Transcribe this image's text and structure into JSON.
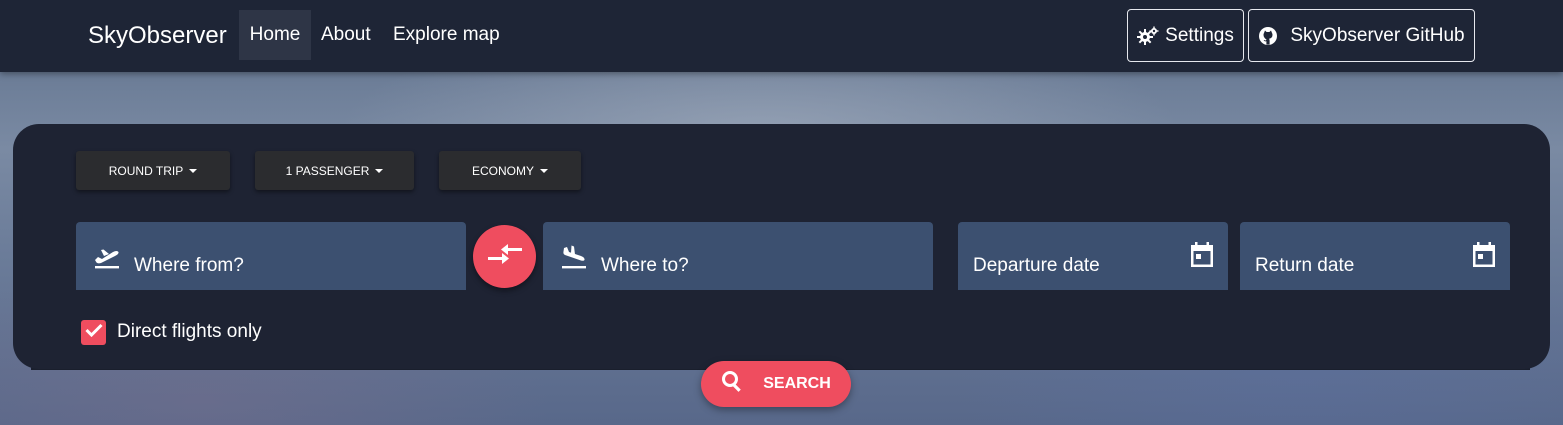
{
  "nav": {
    "brand": "SkyObserver",
    "links": [
      {
        "label": "Home",
        "active": true
      },
      {
        "label": "About",
        "active": false
      },
      {
        "label": "Explore map",
        "active": false
      }
    ],
    "settings_label": "Settings",
    "github_label": "SkyObserver GitHub"
  },
  "search": {
    "trip_type": "ROUND TRIP",
    "passengers": "1 PASSENGER",
    "cabin_class": "ECONOMY",
    "from_label": "Where from?",
    "to_label": "Where to?",
    "departure_label": "Departure date",
    "return_label": "Return date",
    "direct_only_label": "Direct flights only",
    "direct_only_checked": true,
    "search_label": "SEARCH"
  },
  "icons": {
    "settings": "gears-icon",
    "github": "github-icon",
    "from": "plane-takeoff-icon",
    "to": "plane-landing-icon",
    "date": "calendar-icon",
    "swap": "swap-arrows-icon",
    "search": "search-icon",
    "check": "checkmark-icon"
  },
  "colors": {
    "navbar": "#1e2536",
    "panel": "#1e2333",
    "field": "#3c5070",
    "accent": "#ef4d5f",
    "dropdown": "#2b2c2f"
  }
}
